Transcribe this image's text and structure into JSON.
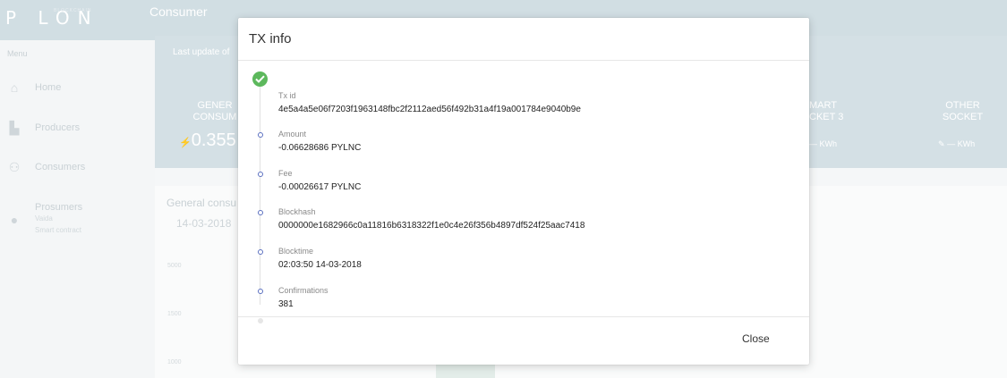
{
  "app": {
    "logo": "P  LON",
    "logo_tag": "BLOCKCHAIN",
    "page_title": "Consumer",
    "menu_label": "Menu"
  },
  "sidebar": {
    "items": [
      {
        "label": "Home",
        "icon": "home-icon"
      },
      {
        "label": "Producers",
        "icon": "factory-icon"
      },
      {
        "label": "Consumers",
        "icon": "users-icon"
      },
      {
        "label": "Prosumers",
        "icon": "user-icon",
        "sub": [
          "Vaida",
          "Smart contract"
        ]
      }
    ]
  },
  "hero": {
    "last_update": "Last update of",
    "stats": [
      {
        "title_line1": "GENER",
        "title_line2": "CONSUM",
        "value": "0.355"
      },
      {
        "title_line1": "MART",
        "title_line2": "CKET 3",
        "value": "—",
        "unit": "KWh"
      },
      {
        "title_line1": "OTHER",
        "title_line2": "SOCKET",
        "value": "—",
        "unit": "KWh"
      }
    ]
  },
  "card": {
    "title": "General consu",
    "date": "14-03-2018",
    "ticks": [
      "5000",
      "1500",
      "1000"
    ]
  },
  "modal": {
    "title": "TX info",
    "fields": [
      {
        "label": "Tx id",
        "value": "4e5a4a5e06f7203f1963148fbc2f2112aed56f492b31a4f19a001784e9040b9e"
      },
      {
        "label": "Amount",
        "value": "-0.06628686 PYLNC"
      },
      {
        "label": "Fee",
        "value": "-0.00026617 PYLNC"
      },
      {
        "label": "Blockhash",
        "value": "0000000e1682966c0a11816b6318322f1e0c4e26f356b4897df524f25aac7418"
      },
      {
        "label": "Blocktime",
        "value": "02:03:50 14-03-2018"
      },
      {
        "label": "Confirmations",
        "value": "381"
      }
    ],
    "close_label": "Close",
    "colors": {
      "success": "#5cb85c",
      "timeline_dot": "#5a6fc0"
    }
  }
}
